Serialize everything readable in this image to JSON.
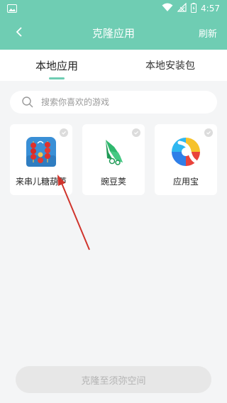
{
  "status_bar": {
    "time": "4:57"
  },
  "app_bar": {
    "title": "克隆应用",
    "refresh_label": "刷新"
  },
  "tabs": [
    {
      "label": "本地应用",
      "active": true
    },
    {
      "label": "本地安装包",
      "active": false
    }
  ],
  "search": {
    "placeholder": "搜索你喜欢的游戏"
  },
  "apps": [
    {
      "name": "来串儿糖葫芦",
      "icon": "candied-haws-game-icon",
      "selected": false
    },
    {
      "name": "豌豆荚",
      "icon": "wandoujia-icon",
      "selected": false
    },
    {
      "name": "应用宝",
      "icon": "yingyongbao-icon",
      "selected": false
    }
  ],
  "clone_button": {
    "label": "克隆至须弥空间",
    "enabled": false
  },
  "colors": {
    "accent": "#6fcdb3",
    "annotation_arrow": "#d0342c"
  }
}
